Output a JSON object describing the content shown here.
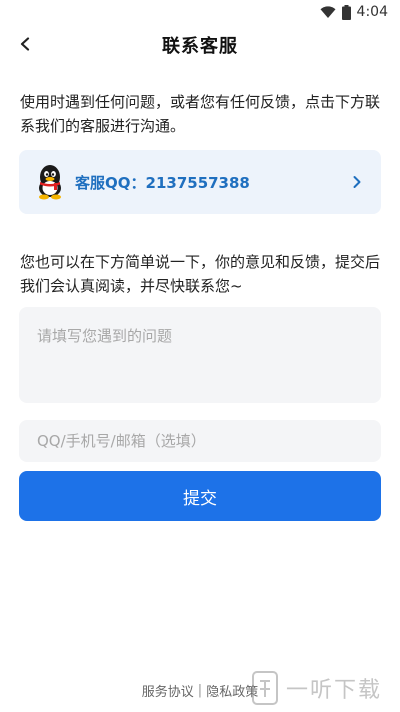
{
  "status_bar": {
    "time": "4:04",
    "icons": [
      "wifi-icon",
      "battery-icon"
    ]
  },
  "header": {
    "title": "联系客服",
    "back_icon": "chevron-left-icon"
  },
  "intro_text": "使用时遇到任何问题，或者您有任何反馈，点击下方联系我们的客服进行沟通。",
  "qq_card": {
    "label": "客服QQ：2137557388",
    "icon": "qq-penguin-icon",
    "arrow_icon": "chevron-right-icon",
    "label_color": "#1f6fbf"
  },
  "feedback_intro": "您也可以在下方简单说一下，你的意见和反馈，提交后我们会认真阅读，并尽快联系您~",
  "form": {
    "problem_placeholder": "请填写您遇到的问题",
    "contact_placeholder": "QQ/手机号/邮箱（选填）",
    "submit_label": "提交",
    "accent_color": "#1d72e8"
  },
  "footer": {
    "service_agreement": "服务协议",
    "separator": "|",
    "privacy_policy": "隐私政策"
  },
  "watermark": {
    "text": "一听下载"
  }
}
